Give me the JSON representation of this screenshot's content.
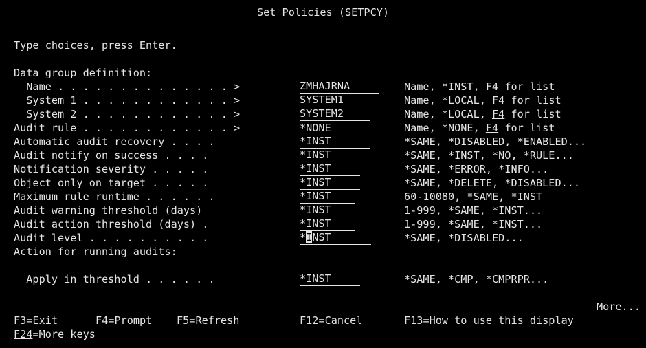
{
  "header": {
    "title": "Set Policies (SETPCY)"
  },
  "instructions": {
    "prefix": "Type choices, press ",
    "enter": "Enter",
    "suffix": "."
  },
  "labels": {
    "data_group": "Data group definition:",
    "name": "  Name . . . . . . . . . . . . . . >",
    "system1": "  System 1 . . . . . . . . . . . . >",
    "system2": "  System 2 . . . . . . . . . . . . >",
    "audit_rule": "Audit rule . . . . . . . . . . . . >",
    "auto_recovery": "Automatic audit recovery . . . .",
    "notify_success": "Audit notify on success . . . .",
    "notify_severity": "Notification severity . . . . .",
    "object_only": "Object only on target . . . . .",
    "max_runtime": "Maximum rule runtime . . . . . .",
    "warn_threshold": "Audit warning threshold (days)",
    "action_threshold": "Audit action threshold (days) .",
    "audit_level": "Audit level . . . . . . . . . .",
    "action_running": "Action for running audits:",
    "apply_threshold": "  Apply in threshold . . . . . ."
  },
  "values": {
    "name": "ZMHAJRNA",
    "system1": "SYSTEM1",
    "system2": "SYSTEM2",
    "audit_rule": "*NONE",
    "auto_recovery": "*INST",
    "notify_success": "*INST",
    "notify_severity": "*INST",
    "object_only": "*INST",
    "max_runtime": "*INST",
    "warn_threshold": "*INST",
    "action_threshold": "*INST",
    "audit_level_first": "*",
    "audit_level_cursor": "I",
    "audit_level_rest": "NST",
    "apply_threshold": "*INST"
  },
  "hints": {
    "name_a": "Name, *INST, ",
    "name_f4": "F4",
    "name_b": " for list",
    "system1_a": "Name, *LOCAL, ",
    "system1_f4": "F4",
    "system1_b": " for list",
    "system2_a": "Name, *LOCAL, ",
    "system2_f4": "F4",
    "system2_b": " for list",
    "audit_rule_a": "Name, *NONE, ",
    "audit_rule_f4": "F4",
    "audit_rule_b": " for list",
    "auto_recovery": "*SAME, *DISABLED, *ENABLED...",
    "notify_success": "*SAME, *INST, *NO, *RULE...",
    "notify_severity": "*SAME, *ERROR, *INFO...",
    "object_only": "*SAME, *DELETE, *DISABLED...",
    "max_runtime": "60-10080, *SAME, *INST",
    "warn_threshold": "1-999, *SAME, *INST...",
    "action_threshold": "1-999, *SAME, *INST...",
    "audit_level": "*SAME, *DISABLED...",
    "apply_threshold": "*SAME, *CMP, *CMPRPR..."
  },
  "more": "More...",
  "function_keys": {
    "f3_key": "F3",
    "f3_label": "=Exit",
    "f4_key": "F4",
    "f4_label": "=Prompt",
    "f5_key": "F5",
    "f5_label": "=Refresh",
    "f12_key": "F12",
    "f12_label": "=Cancel",
    "f13_key": "F13",
    "f13_label": "=How to use this display",
    "f24_key": "F24",
    "f24_label": "=More keys"
  }
}
